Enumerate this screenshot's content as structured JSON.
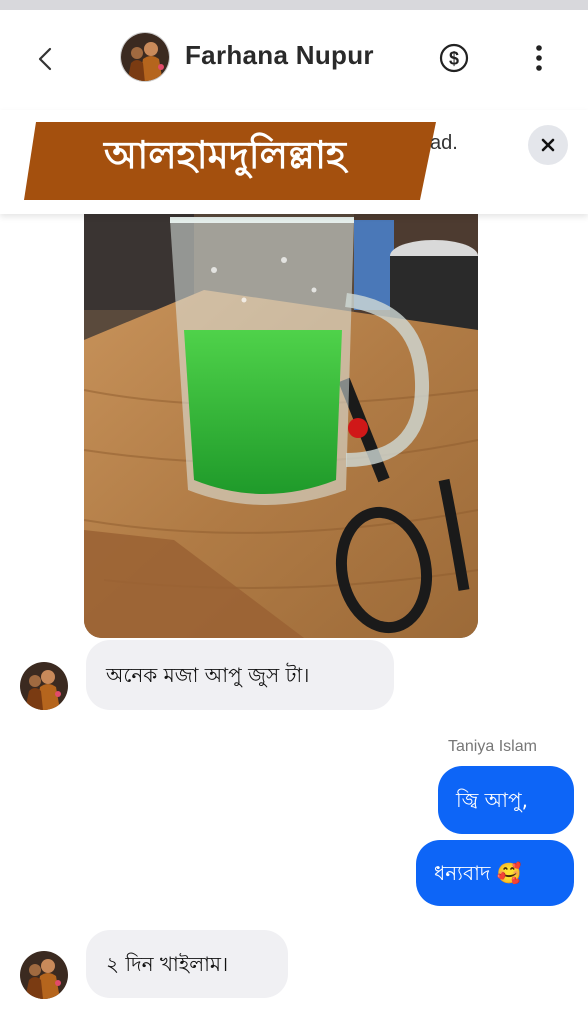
{
  "header": {
    "contact_name": "Farhana Nupur",
    "back_icon": "chevron-left-icon",
    "payment_icon": "dollar-circle-icon",
    "more_icon": "more-vertical-icon"
  },
  "banner": {
    "headline": "আলহামদুলিল্লাহ",
    "ad_text": "ad.",
    "close_icon": "close-icon",
    "ribbon_color": "#a4500e"
  },
  "messages": {
    "incoming_1": "অনেক মজা আপু জুস টা।",
    "sender_name": "Taniya Islam",
    "outgoing_1": "জ্বি আপু,",
    "outgoing_2": "ধন্যবাদ 🥰",
    "incoming_2": "২ দিন খাইলাম।"
  },
  "colors": {
    "outgoing_bubble": "#0d65f7",
    "incoming_bubble": "#f0f0f3"
  }
}
